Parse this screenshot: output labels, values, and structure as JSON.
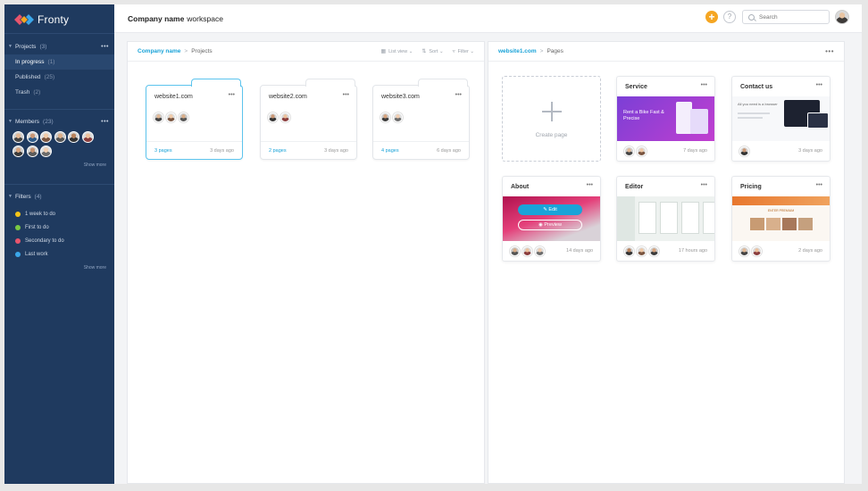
{
  "app": {
    "name": "Fronty"
  },
  "colors": {
    "sidebar": "#1f3a5f",
    "accent": "#1aa3d8",
    "brand_orange": "#f5a623"
  },
  "sidebar": {
    "projects": {
      "label": "Projects",
      "count": "(3)",
      "items": [
        {
          "label": "In progress",
          "count": "(1)"
        },
        {
          "label": "Published",
          "count": "(25)"
        },
        {
          "label": "Trash",
          "count": "(2)"
        }
      ]
    },
    "members": {
      "label": "Members",
      "count": "(23)",
      "show_more": "Show more"
    },
    "filters": {
      "label": "Filters",
      "count": "(4)",
      "show_more": "Show more",
      "items": [
        {
          "label": "1 week to do",
          "color": "#f5c518"
        },
        {
          "label": "First to do",
          "color": "#7ac943"
        },
        {
          "label": "Secondary to do",
          "color": "#e8556d"
        },
        {
          "label": "Last work",
          "color": "#3ba7ea"
        }
      ]
    }
  },
  "header": {
    "company": "Company name",
    "workspace": "workspace",
    "help": "?",
    "add": "+",
    "search_placeholder": "Search"
  },
  "projects_panel": {
    "breadcrumb_root": "Company name",
    "breadcrumb_current": "Projects",
    "tools": {
      "view": "List view",
      "sort": "Sort",
      "filter": "Filter"
    },
    "folders": [
      {
        "title": "website1.com",
        "pages": "3 pages",
        "time": "3 days ago"
      },
      {
        "title": "website2.com",
        "pages": "2 pages",
        "time": "3 days ago"
      },
      {
        "title": "website3.com",
        "pages": "4 pages",
        "time": "6 days ago"
      }
    ]
  },
  "pages_panel": {
    "breadcrumb_root": "website1.com",
    "breadcrumb_current": "Pages",
    "create_label": "Create page",
    "pages": [
      {
        "title": "Service",
        "time": "7 days ago",
        "hero": "Rent a Bike Fast & Precise"
      },
      {
        "title": "Contact us",
        "time": "3 days ago",
        "hero": "All you need is a browser"
      },
      {
        "title": "About",
        "time": "14 days ago",
        "edit": "Edit",
        "preview": "Preview"
      },
      {
        "title": "Editor",
        "time": "17 hours ago"
      },
      {
        "title": "Pricing",
        "time": "2 days ago",
        "hero": "ENTER PREMIUM"
      }
    ]
  },
  "ui": {
    "dots": "•••",
    "sep": ">"
  }
}
